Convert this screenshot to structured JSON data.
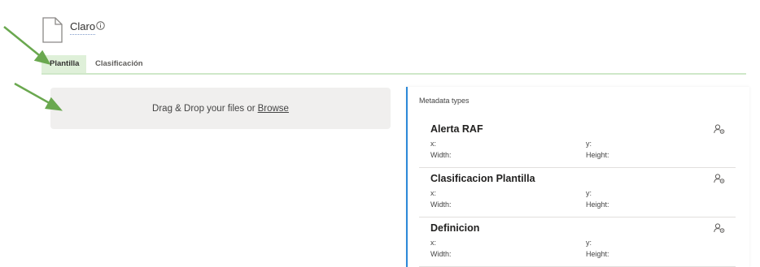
{
  "header": {
    "title": "Claro",
    "info_icon": "info-icon",
    "doc_icon": "document-icon"
  },
  "tabs": [
    {
      "label": "Plantilla",
      "active": true
    },
    {
      "label": "Clasificación",
      "active": false
    }
  ],
  "dropzone": {
    "text": "Drag & Drop your files or",
    "link": "Browse"
  },
  "metadata": {
    "title": "Metadata types",
    "items": [
      {
        "name": "Alerta RAF",
        "x_label": "x:",
        "y_label": "y:",
        "width_label": "Width:",
        "height_label": "Height:",
        "action_icon": "user-settings-icon"
      },
      {
        "name": "Clasificacion Plantilla",
        "x_label": "x:",
        "y_label": "y:",
        "width_label": "Width:",
        "height_label": "Height:",
        "action_icon": "user-settings-icon"
      },
      {
        "name": "Definicion",
        "x_label": "x:",
        "y_label": "y:",
        "width_label": "Width:",
        "height_label": "Height:",
        "action_icon": "user-settings-icon"
      }
    ]
  },
  "colors": {
    "accent": "#2b88d8",
    "tab_active_bg": "#dff0d9",
    "tab_rail": "#cfe8c9",
    "arrow": "#6aa84f"
  }
}
